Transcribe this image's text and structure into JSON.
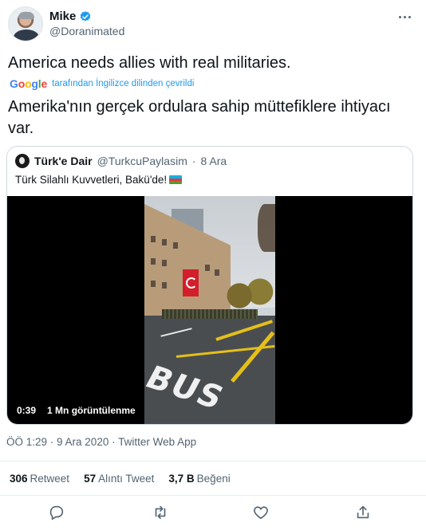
{
  "author": {
    "name": "Mike",
    "handle": "@Doranimated",
    "verified_icon": "verified-badge-icon"
  },
  "tweet": {
    "text": "America needs allies with real militaries.",
    "translation_source": "Google",
    "translation_note": "tarafından İngilizce dilinden çevrildi",
    "translated_text": "Amerika'nın gerçek ordulara sahip müttefiklere ihtiyacı var."
  },
  "quote": {
    "name": "Türk'e Dair",
    "handle": "@TurkcuPaylasim",
    "separator": "·",
    "date": "8 Ara",
    "text": "Türk Silahlı Kuvvetleri, Bakü'de!",
    "flag": "azerbaijan-flag",
    "video": {
      "duration": "0:39",
      "views": "1 Mn görüntülenme",
      "road_text": "BUS"
    }
  },
  "meta": {
    "text": "ÖÖ 1:29 · 9 Ara 2020 · Twitter Web App"
  },
  "stats": [
    {
      "value": "306",
      "label": "Retweet"
    },
    {
      "value": "57",
      "label": "Alıntı Tweet"
    },
    {
      "value": "3,7 B",
      "label": "Beğeni"
    }
  ],
  "colors": {
    "accent": "#1d9bf0",
    "text": "#0f1419",
    "muted": "#536471",
    "border": "#cfd9de"
  }
}
